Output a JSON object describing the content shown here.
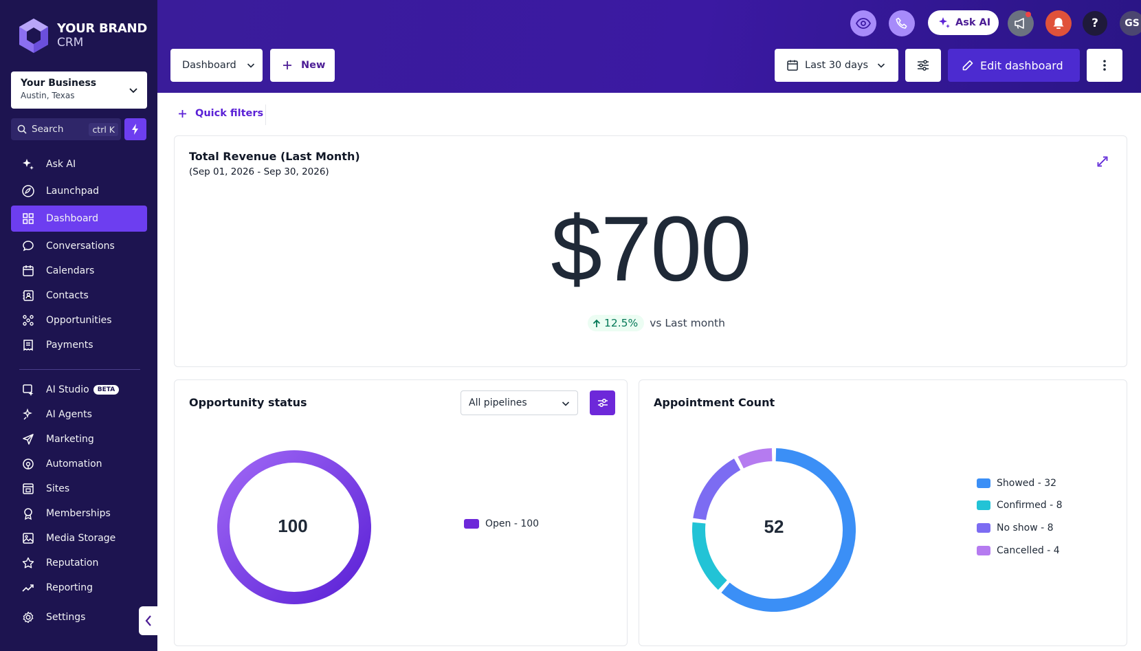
{
  "brand": {
    "name": "YOUR BRAND",
    "sub": "CRM"
  },
  "business": {
    "name": "Your Business",
    "location": "Austin, Texas"
  },
  "search": {
    "label": "Search",
    "shortcut": "ctrl K"
  },
  "nav": {
    "items": [
      {
        "label": "Ask AI",
        "icon": "sparkle-icon"
      },
      {
        "label": "Launchpad",
        "icon": "rocket-icon"
      },
      {
        "label": "Dashboard",
        "icon": "grid-icon"
      },
      {
        "label": "Conversations",
        "icon": "chat-icon"
      },
      {
        "label": "Calendars",
        "icon": "calendar-icon"
      },
      {
        "label": "Contacts",
        "icon": "contacts-icon"
      },
      {
        "label": "Opportunities",
        "icon": "opportunities-icon"
      },
      {
        "label": "Payments",
        "icon": "payments-icon"
      }
    ],
    "items2": [
      {
        "label": "AI Studio",
        "icon": "ai-studio-icon",
        "badge": "BETA"
      },
      {
        "label": "AI Agents",
        "icon": "ai-agents-icon"
      },
      {
        "label": "Marketing",
        "icon": "send-icon"
      },
      {
        "label": "Automation",
        "icon": "automation-icon"
      },
      {
        "label": "Sites",
        "icon": "sites-icon"
      },
      {
        "label": "Memberships",
        "icon": "memberships-icon"
      },
      {
        "label": "Media Storage",
        "icon": "image-icon"
      },
      {
        "label": "Reputation",
        "icon": "star-icon"
      },
      {
        "label": "Reporting",
        "icon": "trend-icon"
      },
      {
        "label": "Settings",
        "icon": "gear-icon"
      }
    ]
  },
  "toolbar": {
    "dashboard_select": "Dashboard",
    "new_label": "New",
    "date_range": "Last 30 days",
    "edit_label": "Edit dashboard",
    "ask_ai_label": "Ask AI",
    "avatar_initials": "GS",
    "help": "?"
  },
  "quick_filters": "Quick filters",
  "revenue": {
    "title": "Total Revenue (Last Month)",
    "range": "(Sep 01, 2026 - Sep 30, 2026)",
    "value": "$700",
    "change": "12.5%",
    "change_label": "vs Last month"
  },
  "opportunity": {
    "title": "Opportunity status",
    "pipeline_select": "All pipelines",
    "total": "100",
    "legend": [
      {
        "label": "Open - 100",
        "color": "#6d28d9"
      }
    ]
  },
  "appointments": {
    "title": "Appointment Count",
    "total": "52",
    "legend": [
      {
        "label": "Showed - 32",
        "color": "#3b8ff6"
      },
      {
        "label": "Confirmed - 8",
        "color": "#22c3d6"
      },
      {
        "label": "No show - 8",
        "color": "#7c6cf2"
      },
      {
        "label": "Cancelled - 4",
        "color": "#b57bf0"
      }
    ]
  },
  "chart_data": [
    {
      "type": "pie",
      "title": "Opportunity status",
      "categories": [
        "Open"
      ],
      "values": [
        100
      ],
      "center_label": "100"
    },
    {
      "type": "pie",
      "title": "Appointment Count",
      "categories": [
        "Showed",
        "Confirmed",
        "No show",
        "Cancelled"
      ],
      "values": [
        32,
        8,
        8,
        4
      ],
      "center_label": "52"
    }
  ],
  "colors": {
    "sidebar": "#1d1450",
    "accent": "#6d3ef0",
    "header": "#3b19a2",
    "positive": "#047857",
    "notification": "#e53e3e"
  }
}
